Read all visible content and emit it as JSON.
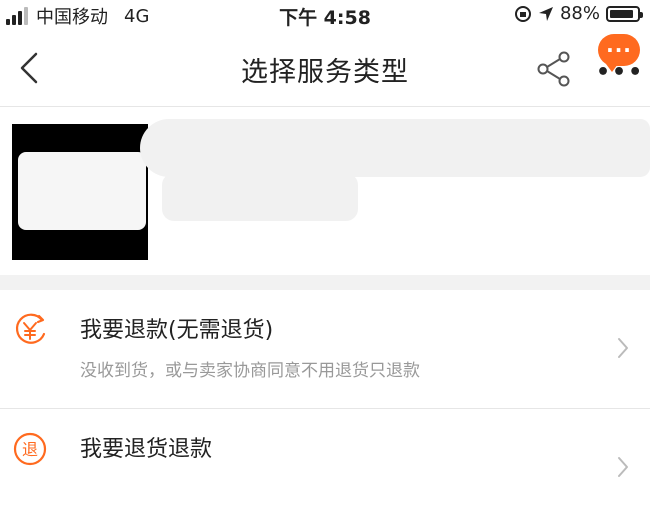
{
  "status_bar": {
    "carrier": "中国移动",
    "network": "4G",
    "time": "下午 4:58",
    "battery": "88%",
    "battery_level": 0.88
  },
  "nav": {
    "title": "选择服务类型",
    "more_badge": "···",
    "more_dots": "•••"
  },
  "options": [
    {
      "title": "我要退款(无需退货)",
      "desc": "没收到货，或与卖家协商同意不用退货只退款",
      "icon": "refund-yuan-icon"
    },
    {
      "title": "我要退货退款",
      "desc": "",
      "icon": "return-tui-icon",
      "icon_text": "退"
    }
  ],
  "colors": {
    "accent": "#ff6a1f",
    "muted": "#999999"
  }
}
